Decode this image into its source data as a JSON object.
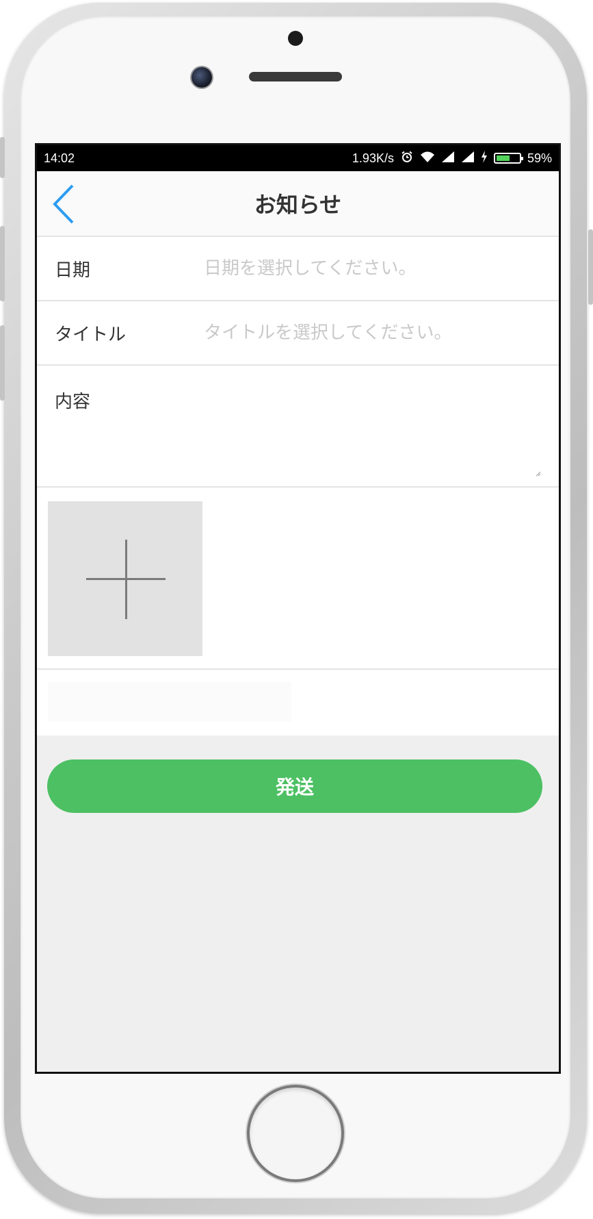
{
  "status_bar": {
    "time": "14:02",
    "network_speed": "1.93K/s",
    "battery_percent": "59%",
    "battery_level": 0.59,
    "icons": [
      "alarm-icon",
      "wifi-icon",
      "signal-icon",
      "signal-icon",
      "charging-icon",
      "battery-icon"
    ]
  },
  "nav": {
    "back_icon": "chevron-left-icon",
    "title": "お知らせ"
  },
  "form": {
    "date": {
      "label": "日期",
      "placeholder": "日期を選択してください。",
      "value": ""
    },
    "title": {
      "label": "タイトル",
      "placeholder": "タイトルを選択してください。",
      "value": ""
    },
    "content": {
      "label": "内容",
      "value": ""
    }
  },
  "photo": {
    "add_icon": "plus-icon"
  },
  "send_button": {
    "label": "発送"
  },
  "colors": {
    "accent_blue": "#2d9cf0",
    "send_green": "#4cc063",
    "screen_bg": "#efefef",
    "placeholder_gray": "#c9c9c9"
  }
}
